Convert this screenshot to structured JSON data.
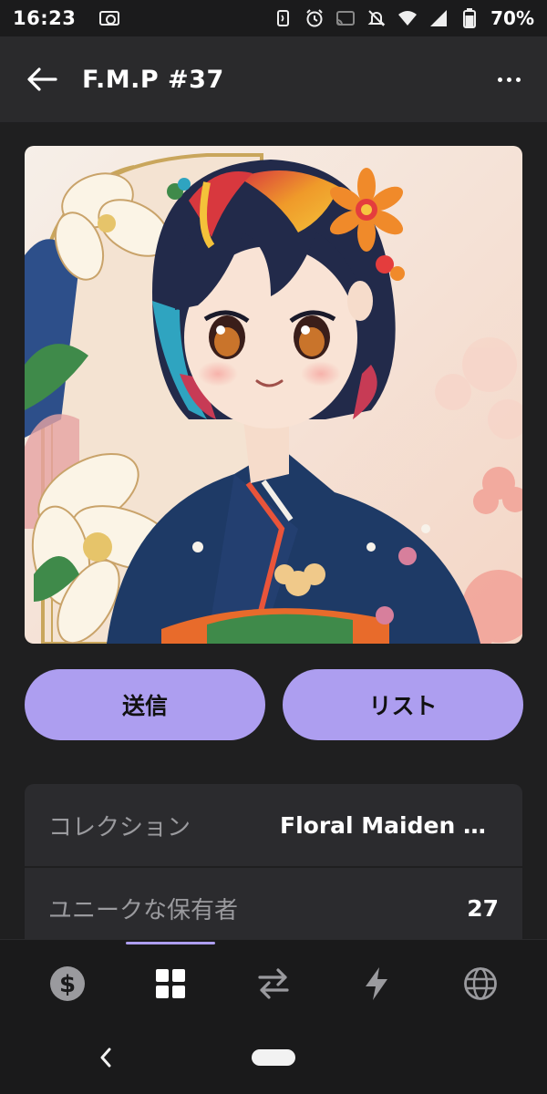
{
  "status_bar": {
    "time": "16:23",
    "battery": "70%",
    "icons": [
      "camera-icon",
      "nfc-icon",
      "alarm-icon",
      "cast-icon",
      "notifications-off-icon",
      "wifi-icon",
      "signal-icon",
      "battery-icon"
    ]
  },
  "app_bar": {
    "title": "F.M.P #37",
    "back_icon": "arrow-left-icon",
    "more_icon": "more-horizontal-icon"
  },
  "artwork": {
    "subject": "anime-girl-kimono-floral-illustration"
  },
  "actions": {
    "send_label": "送信",
    "list_label": "リスト",
    "button_color": "#ad9ef0"
  },
  "details": [
    {
      "label": "コレクション",
      "value": "Floral Maiden Portraits"
    },
    {
      "label": "ユニークな保有者",
      "value": "27"
    }
  ],
  "bottom_nav": {
    "active_index": 1,
    "items": [
      {
        "icon": "dollar-coin-icon"
      },
      {
        "icon": "grid-icon"
      },
      {
        "icon": "swap-arrows-icon"
      },
      {
        "icon": "lightning-icon"
      },
      {
        "icon": "globe-icon"
      }
    ]
  },
  "colors": {
    "background": "#1f1f20",
    "app_bar": "#2a2a2c",
    "card": "#2b2b2e",
    "accent": "#ad9ef0"
  }
}
